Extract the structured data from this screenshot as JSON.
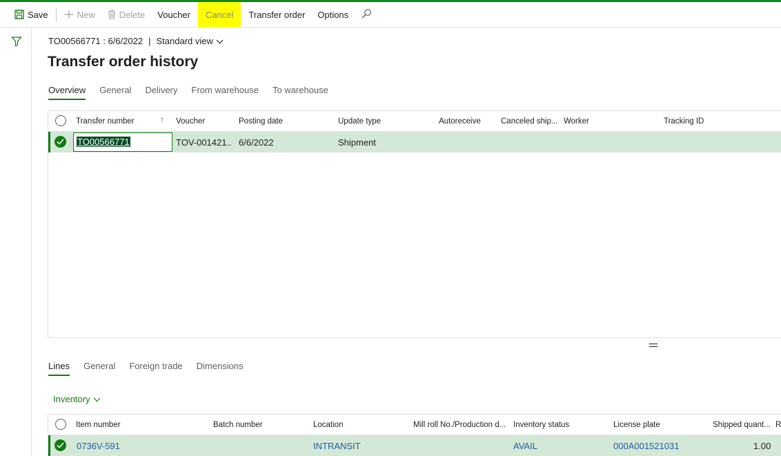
{
  "colors": {
    "accent": "#107c10",
    "row_selected": "#d3e8d6",
    "highlight": "#ffff00",
    "link": "#1f5ca8"
  },
  "actionbar": {
    "save": "Save",
    "new": "New",
    "delete": "Delete",
    "voucher": "Voucher",
    "cancel": "Cancel",
    "transfer_order": "Transfer order",
    "options": "Options"
  },
  "header": {
    "record": "TO00566771 : 6/6/2022",
    "separator": "|",
    "view": "Standard view",
    "title": "Transfer order history"
  },
  "top_tabs": [
    "Overview",
    "General",
    "Delivery",
    "From warehouse",
    "To warehouse"
  ],
  "history_grid": {
    "columns": [
      "Transfer number",
      "Voucher",
      "Posting date",
      "Update type",
      "Autoreceive",
      "Canceled ship...",
      "Worker",
      "Tracking ID"
    ],
    "sort_indicator": "↑",
    "rows": [
      {
        "transfer_number": "TO00566771",
        "voucher": "TOV-001421...",
        "posting_date": "6/6/2022",
        "update_type": "Shipment",
        "autoreceive": "",
        "canceled": "",
        "worker": "",
        "tracking_id": ""
      }
    ]
  },
  "lines_tabs": [
    "Lines",
    "General",
    "Foreign trade",
    "Dimensions"
  ],
  "inventory_menu": "Inventory",
  "lines_grid": {
    "columns": [
      "Item number",
      "Batch number",
      "Location",
      "Mill roll No./Production d...",
      "Inventory status",
      "License plate",
      "Shipped quant...",
      "Re"
    ],
    "rows": [
      {
        "item_number": "0736V-591",
        "batch_number": "",
        "location": "INTRANSIT",
        "mill_roll": "",
        "inventory_status": "AVAIL",
        "license_plate": "000A001521031",
        "shipped_qty": "1.00"
      }
    ]
  }
}
